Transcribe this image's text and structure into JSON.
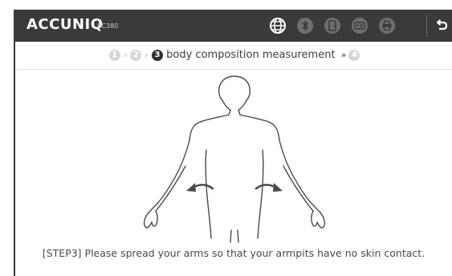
{
  "header": {
    "logo": "ACCUNIQ",
    "model": "BC380",
    "icons": [
      "globe-icon",
      "bluetooth-icon",
      "door-icon",
      "id-card-icon",
      "printer-icon",
      "back-icon"
    ]
  },
  "progress": {
    "steps": [
      {
        "number": "1",
        "state": "done"
      },
      {
        "number": "2",
        "state": "done"
      },
      {
        "number": "3",
        "state": "active",
        "label": "body composition measurement"
      },
      {
        "number": "4",
        "state": "pending"
      }
    ],
    "separator": "»"
  },
  "instruction": "[STEP3] Please spread your arms so that your armpits have no skin contact.",
  "colors": {
    "header_bg": "#3a3a3a",
    "active_step": "#2f2f2f",
    "inactive_step": "#d7d7d7"
  }
}
